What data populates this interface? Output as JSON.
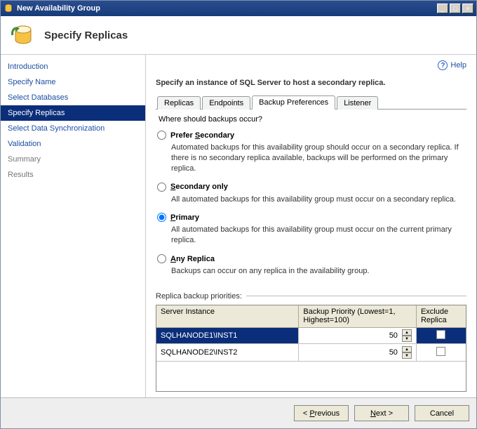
{
  "window": {
    "title": "New Availability Group"
  },
  "header": {
    "title": "Specify Replicas"
  },
  "help": {
    "label": "Help"
  },
  "sidebar": {
    "items": [
      {
        "label": "Introduction",
        "active": false,
        "muted": false
      },
      {
        "label": "Specify Name",
        "active": false,
        "muted": false
      },
      {
        "label": "Select Databases",
        "active": false,
        "muted": false
      },
      {
        "label": "Specify Replicas",
        "active": true,
        "muted": false
      },
      {
        "label": "Select Data Synchronization",
        "active": false,
        "muted": false
      },
      {
        "label": "Validation",
        "active": false,
        "muted": false
      },
      {
        "label": "Summary",
        "active": false,
        "muted": true
      },
      {
        "label": "Results",
        "active": false,
        "muted": true
      }
    ]
  },
  "main": {
    "instruction": "Specify an instance of SQL Server to host a secondary replica.",
    "tabs": [
      {
        "label": "Replicas",
        "active": false
      },
      {
        "label": "Endpoints",
        "active": false
      },
      {
        "label": "Backup Preferences",
        "active": true
      },
      {
        "label": "Listener",
        "active": false
      }
    ],
    "question": "Where should backups occur?",
    "options": [
      {
        "label_pre": "Prefer ",
        "ul": "S",
        "label_post": "econdary",
        "checked": false,
        "desc": "Automated backups for this availability group should occur on a secondary replica. If there is no secondary replica available, backups will be performed on the primary replica."
      },
      {
        "label_pre": "",
        "ul": "S",
        "label_post": "econdary only",
        "checked": false,
        "desc": "All automated backups for this availability group must occur on a secondary replica."
      },
      {
        "label_pre": "",
        "ul": "P",
        "label_post": "rimary",
        "checked": true,
        "desc": "All automated backups for this availability group must occur on the current primary replica."
      },
      {
        "label_pre": "",
        "ul": "A",
        "label_post": "ny Replica",
        "checked": false,
        "desc": "Backups can occur on any replica in the availability group."
      }
    ],
    "priorities_label": "Replica backup priorities:",
    "grid": {
      "columns": [
        "Server Instance",
        "Backup Priority (Lowest=1, Highest=100)",
        "Exclude Replica"
      ],
      "rows": [
        {
          "instance": "SQLHANODE1\\INST1",
          "priority": "50",
          "exclude": false,
          "selected": true
        },
        {
          "instance": "SQLHANODE2\\INST2",
          "priority": "50",
          "exclude": false,
          "selected": false
        }
      ]
    }
  },
  "footer": {
    "prev_pre": "< ",
    "prev_ul": "P",
    "prev_post": "revious",
    "next_pre": "",
    "next_ul": "N",
    "next_post": "ext >",
    "cancel": "Cancel"
  }
}
